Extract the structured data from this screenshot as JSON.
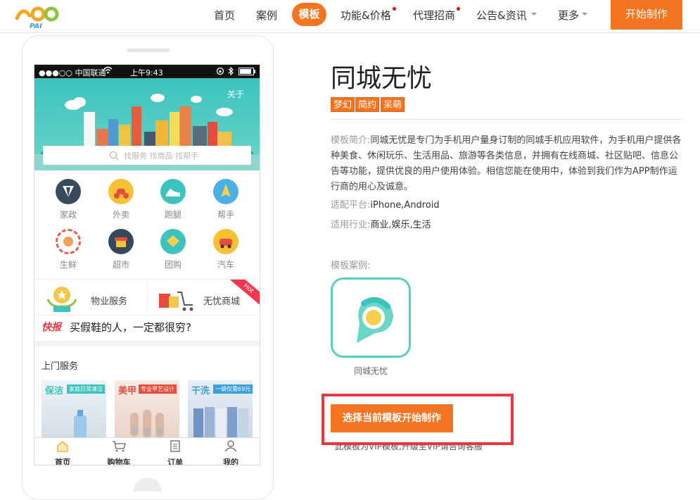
{
  "header": {
    "logo_text": "PAI",
    "nav": [
      {
        "label": "首页"
      },
      {
        "label": "案例"
      },
      {
        "label": "模板"
      },
      {
        "label": "功能&价格"
      },
      {
        "label": "代理招商"
      },
      {
        "label": "公告&资讯"
      },
      {
        "label": "更多"
      }
    ],
    "start_button": "开始制作"
  },
  "phone": {
    "status": {
      "carrier": "●●●○○ 中国联通",
      "time": "上午9:43"
    },
    "banner_about": "关于",
    "search_placeholder": "找服务 找商品 找帮手",
    "categories": [
      {
        "label": "家政"
      },
      {
        "label": "外卖"
      },
      {
        "label": "跑腿"
      },
      {
        "label": "帮手"
      },
      {
        "label": "生鲜"
      },
      {
        "label": "超市"
      },
      {
        "label": "团购"
      },
      {
        "label": "汽车"
      }
    ],
    "promos": [
      {
        "label": "物业服务"
      },
      {
        "label": "无忧商城"
      }
    ],
    "hot_badge": "Hot",
    "news_tag": "快报",
    "news_text": "买假鞋的人，一定都很穷?",
    "section_title": "上门服务",
    "services": [
      {
        "title": "保洁",
        "badge": "家庭日常清洁"
      },
      {
        "title": "美甲",
        "badge": "专业甲艺设计"
      },
      {
        "title": "干洗",
        "badge": "一袋仅需69元"
      }
    ],
    "tabs": [
      {
        "label": "首页"
      },
      {
        "label": "购物车"
      },
      {
        "label": "订单"
      },
      {
        "label": "我的"
      }
    ]
  },
  "detail": {
    "title": "同城无忧",
    "tags": [
      "梦幻",
      "简约",
      "呆萌"
    ],
    "desc_key": "模板简介:",
    "desc_text": "同城无忧是专门为手机用户量身订制的同城手机应用软件，为手机用户提供各种美食、休闲玩乐、生活用品、旅游等各类信息，并拥有在线商城、社区贴吧、信息公告等功能，提供优良的用户使用体验。相信您能在使用中，体验到我们作为APP制作运行商的用心及诚意。",
    "platform_key": "适配平台:",
    "platform_val": "iPhone,Android",
    "industry_key": "适用行业:",
    "industry_val": "商业,娱乐,生活",
    "case_label": "模板案例:",
    "case_app_name": "同城无忧",
    "choose_button": "选择当前模板开始制作",
    "footer_partial": "此模板为VIP模板,升级至VIP请咨询客服"
  },
  "colors": {
    "accent": "#f47421",
    "teal": "#3cc3be",
    "highlight": "#e8383d"
  }
}
